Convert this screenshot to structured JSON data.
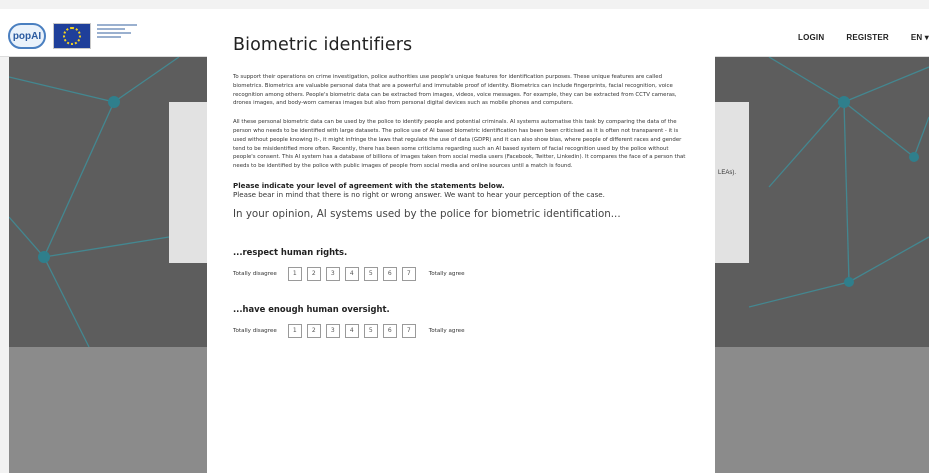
{
  "header": {
    "logo_text": "popAI",
    "nav": {
      "login": "LOGIN",
      "register": "REGISTER",
      "lang": "EN ▾"
    }
  },
  "background": {
    "card_snippet": "LEAs)."
  },
  "modal": {
    "title": "Biometric identifiers",
    "paragraph1": "To support their operations on crime investigation, police authorities use people's unique features for identification purposes. These unique features are called biometrics. Biometrics are valuable personal data that are a powerful and immutable proof of identity. Biometrics can include fingerprints, facial recognition, voice recognition among others. People's biometric data can be extracted from images, videos, voice messages. For example, they can be extracted from CCTV cameras, drones images, and body-worn cameras images but also from personal digital devices such as mobile phones and computers.",
    "paragraph2": "All these personal biometric data can be used by the police to identify people and potential criminals. AI systems automatise this task by comparing the data of the person who needs to be identified with large datasets. The police use of AI based biometric identification has been been criticised as it is often not transparent - it is used without people knowing it-, it might infringe the laws that regulate the use of data (GDPR) and it can also show bias, where people of different races and gender tend to be misidentified more often. Recently, there has been some criticisms regarding such an AI based system of facial recognition used by the police without people's consent. This AI system has a database of billions of images taken from social media users (Facebook, Twitter, Linkedin). It compares the face of a person that needs to be identified by the police with public images of people from social media and online sources until a match is found.",
    "instruction_bold": "Please indicate your level of agreement with the statements below.",
    "instruction_sub": "Please bear in mind that there is no right or wrong answer. We want to hear your perception of the case.",
    "question_lead": "In your opinion, AI systems used by the police for biometric identification...",
    "scale": {
      "left_label": "Totally disagree",
      "right_label": "Totally agree",
      "options": [
        "1",
        "2",
        "3",
        "4",
        "5",
        "6",
        "7"
      ]
    },
    "items": [
      {
        "title": "...respect human rights."
      },
      {
        "title": "...have enough human oversight."
      }
    ]
  }
}
